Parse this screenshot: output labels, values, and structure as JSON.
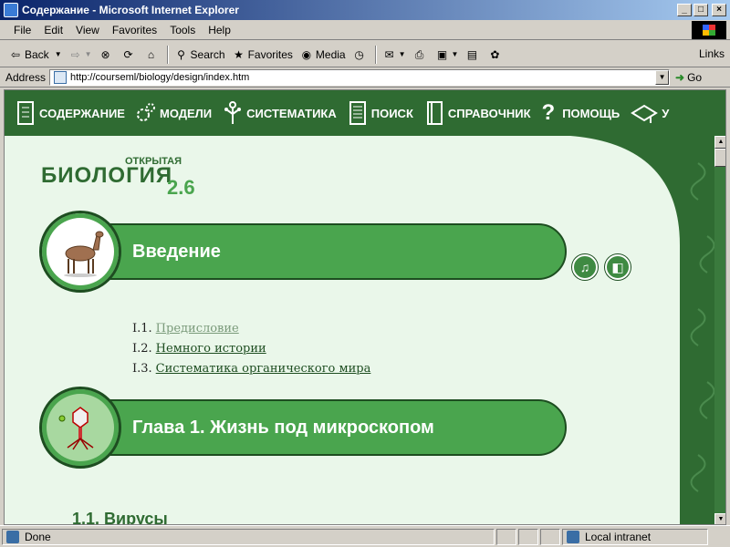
{
  "window": {
    "title": "Содержание - Microsoft Internet Explorer"
  },
  "menu": [
    "File",
    "Edit",
    "View",
    "Favorites",
    "Tools",
    "Help"
  ],
  "toolbar": {
    "back": "Back",
    "search": "Search",
    "favorites": "Favorites",
    "media": "Media",
    "links": "Links"
  },
  "address": {
    "label": "Address",
    "url": "http://courseml/biology/design/index.htm",
    "go": "Go"
  },
  "sitenav": [
    "СОДЕРЖАНИЕ",
    "МОДЕЛИ",
    "СИСТЕМАТИКА",
    "ПОИСК",
    "СПРАВОЧНИК",
    "ПОМОЩЬ",
    "У"
  ],
  "logo": {
    "small": "ОТКРЫТАЯ",
    "big": "БИОЛОГИЯ",
    "version": "2.6"
  },
  "intro": {
    "title": "Введение",
    "items": [
      {
        "num": "I.1.",
        "label": "Предисловие"
      },
      {
        "num": "I.2.",
        "label": "Немного истории"
      },
      {
        "num": "I.3.",
        "label": "Систематика органического мира"
      }
    ]
  },
  "chapter1": {
    "title": "Глава 1. Жизнь под микроскопом",
    "sub": "1.1. Вирусы"
  },
  "status": {
    "text": "Done",
    "zone": "Local intranet"
  },
  "colors": {
    "nav": "#2f6b32",
    "bar": "#4aa54e",
    "page": "#eaf7ea"
  }
}
